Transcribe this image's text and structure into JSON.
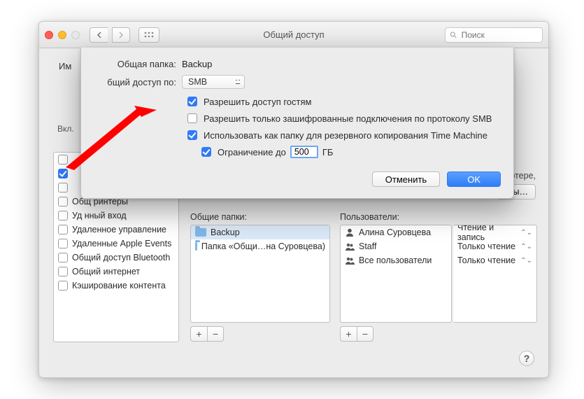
{
  "toolbar": {
    "title": "Общий доступ",
    "search_placeholder": "Поиск"
  },
  "sidebar_partial": {
    "name_label_fragment": "Им",
    "on_header": "Вкл.",
    "services": [
      {
        "checked": false,
        "label": ""
      },
      {
        "checked": true,
        "label": ""
      },
      {
        "checked": false,
        "label": ""
      },
      {
        "checked": false,
        "label": "Общ        ринтеры"
      },
      {
        "checked": false,
        "label": "Уд         нный вход"
      },
      {
        "checked": false,
        "label": "Удаленное управление"
      },
      {
        "checked": false,
        "label": "Удаленные Apple Events"
      },
      {
        "checked": false,
        "label": "Общий доступ Bluetooth"
      },
      {
        "checked": false,
        "label": "Общий интернет"
      },
      {
        "checked": false,
        "label": "Кэширование контента"
      }
    ]
  },
  "background_fragments": {
    "right_text": "льютере,",
    "right_button": "тры…"
  },
  "shared_folders": {
    "header": "Общие папки:",
    "items": [
      {
        "name": "Backup",
        "selected": true
      },
      {
        "name": "Папка «Общи…на Суровцева)",
        "selected": false
      }
    ]
  },
  "users": {
    "header": "Пользователи:",
    "items": [
      {
        "name": "Алина Суровцева",
        "icon": "user"
      },
      {
        "name": "Staff",
        "icon": "group"
      },
      {
        "name": "Все пользователи",
        "icon": "group"
      }
    ]
  },
  "permissions": {
    "items": [
      "Чтение и запись",
      "Только чтение",
      "Только чтение"
    ]
  },
  "sheet": {
    "folder_label": "Общая папка:",
    "folder_value": "Backup",
    "via_label": "бщий доступ по:",
    "via_value": "SMB",
    "opt_guests": "Разрешить доступ гостям",
    "opt_smb_encrypted": "Разрешить только зашифрованные подключения по протоколу SMB",
    "opt_tm": "Использовать как папку для резервного копирования Time Machine",
    "opt_limit_prefix": "Ограничение до",
    "opt_limit_value": "500",
    "opt_limit_suffix": "ГБ",
    "checked": {
      "guests": true,
      "smb": false,
      "tm": true,
      "limit": true
    },
    "cancel": "Отменить",
    "ok": "OK"
  }
}
